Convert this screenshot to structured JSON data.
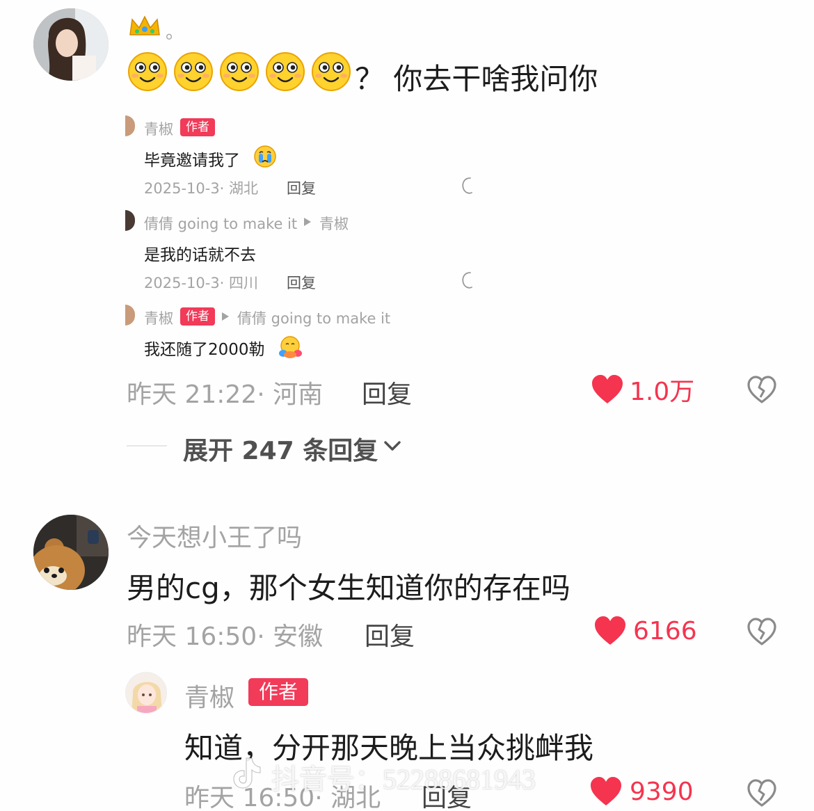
{
  "comment1": {
    "name_suffix": "。",
    "text": "？ 你去干啥我问你",
    "meta": "昨天 21:22· 河南",
    "reply_label": "回复",
    "likes": "1.0万",
    "expand_label": "展开 247 条回复"
  },
  "replies": [
    {
      "author": "青椒",
      "badge": "作者",
      "text": "毕竟邀请我了",
      "meta": "2025-10-3· 湖北",
      "reply_label": "回复"
    },
    {
      "author": "倩倩 going to make it",
      "target": "青椒",
      "text": "是我的话就不去",
      "meta": "2025-10-3· 四川",
      "reply_label": "回复"
    },
    {
      "author": "青椒",
      "badge": "作者",
      "target": "倩倩 going to make it",
      "text": "我还随了2000勒"
    }
  ],
  "comment2": {
    "name": "今天想小王了吗",
    "text": "男的cg，那个女生知道你的存在吗",
    "meta": "昨天 16:50· 安徽",
    "reply_label": "回复",
    "likes": "6166"
  },
  "reply2": {
    "author": "青椒",
    "badge": "作者",
    "text": "知道，分开那天晚上当众挑衅我",
    "meta": "昨天 16:50· 湖北",
    "reply_label": "回复",
    "likes": "9390"
  },
  "watermark": "抖音号：52288681943",
  "colors": {
    "accent": "#f23a59",
    "like": "#f5344f",
    "meta": "#a3a3a3"
  }
}
